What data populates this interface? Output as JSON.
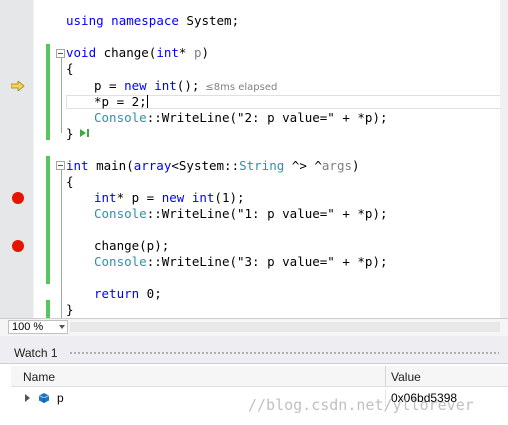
{
  "editor": {
    "lines": {
      "using": {
        "kw1": "using",
        "kw2": "namespace",
        "rest": " System;"
      },
      "change_sig": {
        "kw": "void",
        "name": " change(",
        "kw2": "int",
        "star": "* ",
        "param": "p",
        "close": ")"
      },
      "open1": "{",
      "assign_new": {
        "a": "p = ",
        "kw": "new",
        "sp": " ",
        "kw2": "int",
        "b": "();",
        "perf": "≤8ms elapsed"
      },
      "assign_2": "*p = 2;",
      "write2": {
        "ty": "Console",
        "a": "::WriteLine(\"2: p value=\" + *p);"
      },
      "close1": "}",
      "main_sig": {
        "kw": "int",
        "a": " main(",
        "kw2": "array",
        "b": "<System::",
        "ty": "String",
        "c": " ^> ^",
        "param": "args",
        "d": ")"
      },
      "open2": "{",
      "decl": {
        "kw": "int",
        "a": "* p = ",
        "kw2": "new",
        "sp": " ",
        "kw3": "int",
        "b": "(1);"
      },
      "write1": {
        "ty": "Console",
        "a": "::WriteLine(\"1: p value=\" + *p);"
      },
      "call": "change(p);",
      "write3": {
        "ty": "Console",
        "a": "::WriteLine(\"3: p value=\" + *p);"
      },
      "ret": {
        "kw": "return",
        "a": " 0;"
      },
      "close2": "}"
    },
    "colors": {
      "breakpoint": "#e51400",
      "change_bar": "#56c75f",
      "keyword": "#0000ff",
      "type": "#2b91af"
    }
  },
  "zoom": {
    "level": "100 %"
  },
  "watch": {
    "title": "Watch 1",
    "columns": {
      "name": "Name",
      "value": "Value"
    },
    "rows": [
      {
        "name": "p",
        "value": "0x06bd5398",
        "icon": "variable-cube-icon"
      }
    ]
  },
  "watermark": "//blog.csdn.net/yllorever"
}
